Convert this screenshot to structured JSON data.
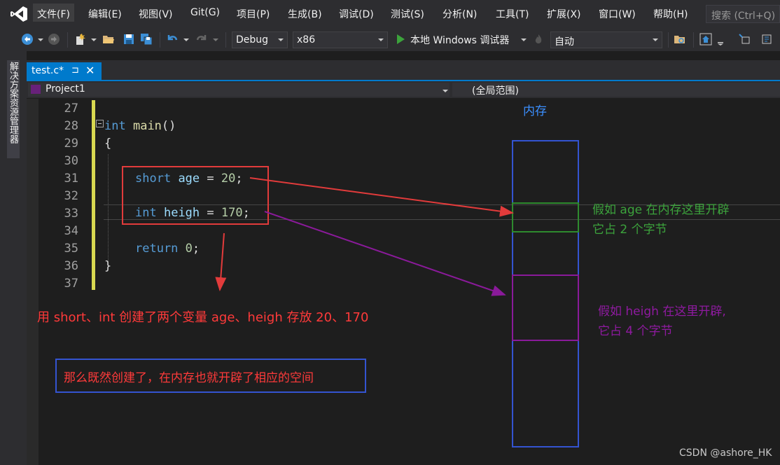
{
  "menubar": {
    "items": [
      "文件(F)",
      "编辑(E)",
      "视图(V)",
      "Git(G)",
      "项目(P)",
      "生成(B)",
      "调试(D)",
      "测试(S)",
      "分析(N)",
      "工具(T)",
      "扩展(X)",
      "窗口(W)",
      "帮助(H)"
    ],
    "search_placeholder": "搜索 (Ctrl+Q)"
  },
  "toolbar": {
    "configuration": "Debug",
    "platform": "x86",
    "run_label": "本地 Windows 调试器",
    "auto_label": "自动"
  },
  "side_panel": {
    "label": "解决方案资源管理器"
  },
  "editor_tab": {
    "title": "test.c*",
    "pin": "⊐",
    "close": "✕"
  },
  "navbar": {
    "project": "Project1",
    "scope": "(全局范围)"
  },
  "editor": {
    "line_numbers": [
      "27",
      "28",
      "29",
      "30",
      "31",
      "32",
      "33",
      "34",
      "35",
      "36",
      "37"
    ],
    "code": {
      "l28_kw": "int",
      "l28_fn": "main",
      "l28_paren": "()",
      "l29": "{",
      "l31_kw": "short",
      "l31_var": "age",
      "l31_eq": " = ",
      "l31_num": "20",
      "l31_end": ";",
      "l33_kw": "int",
      "l33_var": "heigh",
      "l33_eq": " = ",
      "l33_num": "170",
      "l33_end": ";",
      "l35_kw": "return",
      "l35_num": "0",
      "l35_end": ";",
      "l36": "}"
    }
  },
  "annotations": {
    "memory_label": "内存",
    "age_note_line1": "假如 age 在内存这里开辟",
    "age_note_line2": "它占 2 个字节",
    "heigh_note_line1": "假如 heigh 在这里开辟,",
    "heigh_note_line2": "它占 4 个字节",
    "create_note": "用 short、int 创建了两个变量 age、heigh 存放 20、170",
    "space_note": "那么既然创建了，在内存也就开辟了相应的空间",
    "colors": {
      "red": "#e23b3b",
      "green": "#3ca33c",
      "purple": "#8f1aa0",
      "blue": "#3454d1"
    }
  },
  "watermark": "CSDN @ashore_HK",
  "theme": {
    "accent": "#007acc",
    "editor_bg": "#1e1e1e",
    "chrome_bg": "#2d2d30"
  }
}
